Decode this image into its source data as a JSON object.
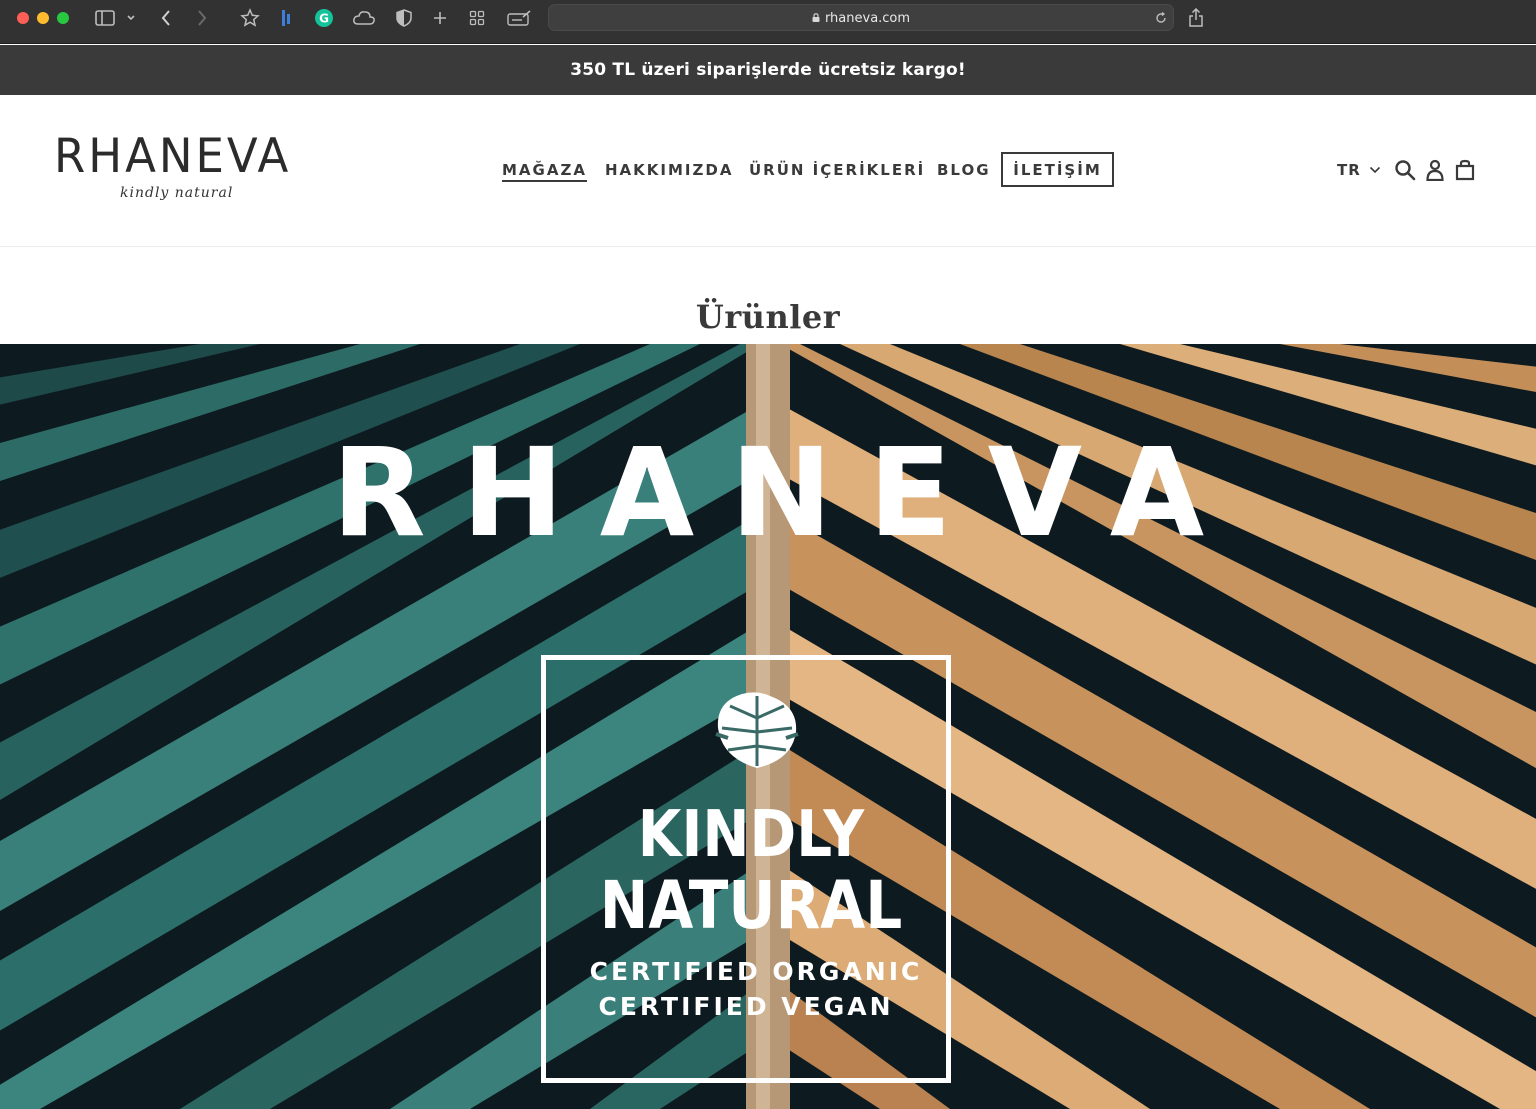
{
  "browser": {
    "url": "rhaneva.com",
    "icons": [
      "sidebar-icon",
      "chevron-down-icon",
      "back-icon",
      "forward-icon",
      "bookmark-star-icon",
      "extension-icon",
      "grammarly-icon",
      "cloud-icon",
      "shield-icon",
      "new-tab-icon",
      "tab-overview-icon",
      "reader-icon",
      "reload-icon",
      "share-icon"
    ]
  },
  "announcement": {
    "text": "350 TL üzeri siparişlerde ücretsiz kargo!"
  },
  "header": {
    "logo_main": "RHANEVA",
    "logo_sub": "kindly natural",
    "nav": [
      {
        "label": "MAĞAZA"
      },
      {
        "label": "HAKKIMIZDA"
      },
      {
        "label": "ÜRÜN İÇERİKLERİ"
      },
      {
        "label": "BLOG"
      },
      {
        "label": "İLETİŞİM"
      }
    ],
    "language": "TR",
    "icons": [
      "search-icon",
      "account-icon",
      "cart-icon"
    ]
  },
  "page": {
    "title": "Ürünler"
  },
  "hero": {
    "brand": "RHANEVA",
    "line1": "KINDLY",
    "line2": "NATURAL",
    "cert1": "CERTIFIED ORGANIC",
    "cert2": "CERTIFIED VEGAN"
  },
  "colors": {
    "chrome": "#323232",
    "announcement_bg": "#3a3a3a",
    "text_dark": "#3a3a3a",
    "teal_leaf": "#2f6e6a",
    "tan_leaf": "#d6a26a"
  }
}
